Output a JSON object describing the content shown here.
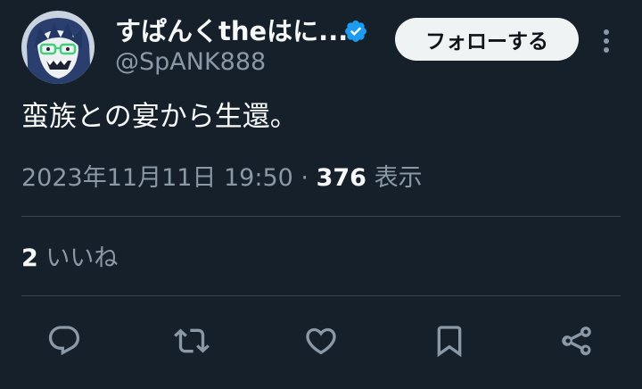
{
  "author": {
    "display_name": "すぱんくtheはに...",
    "handle": "@SpANK888",
    "verified": true,
    "avatar_icon": "anime-avatar-icon"
  },
  "follow_button": {
    "label": "フォローする"
  },
  "more_menu": {
    "icon": "more-vertical-icon"
  },
  "tweet": {
    "text": "蛮族との宴から生還。",
    "timestamp": "2023年11月11日 19:50",
    "separator": "·",
    "views_count": "376",
    "views_label": "表示",
    "likes_count": "2",
    "likes_label": "いいね"
  },
  "actions": [
    {
      "name": "reply",
      "icon": "reply-icon"
    },
    {
      "name": "retweet",
      "icon": "retweet-icon"
    },
    {
      "name": "like",
      "icon": "heart-icon"
    },
    {
      "name": "bookmark",
      "icon": "bookmark-icon"
    },
    {
      "name": "share",
      "icon": "share-icon"
    }
  ],
  "colors": {
    "background": "#15202b",
    "text_primary": "#f7f9f9",
    "text_secondary": "#8b98a5",
    "divider": "#38444d",
    "verified": "#1d9bf0",
    "button_bg": "#eff3f4"
  }
}
